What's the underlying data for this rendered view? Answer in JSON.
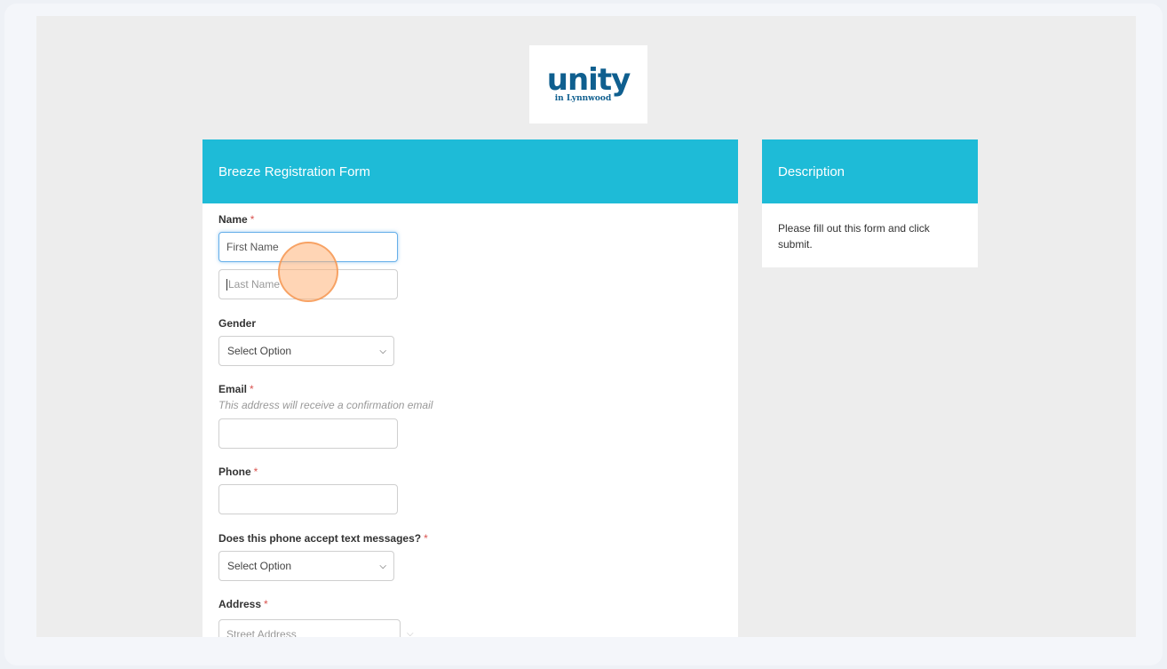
{
  "logo": {
    "word": "unity",
    "sub": "in Lynnwood"
  },
  "form": {
    "title": "Breeze Registration Form",
    "name_label": "Name",
    "first_name_value": "First Name",
    "last_name_placeholder": "Last Name",
    "gender_label": "Gender",
    "gender_value": "Select Option",
    "email_label": "Email",
    "email_help": "This address will receive a confirmation email",
    "phone_label": "Phone",
    "text_label": "Does this phone accept text messages?",
    "text_value": "Select Option",
    "address_label": "Address",
    "street_placeholder": "Street Address",
    "required_mark": "*"
  },
  "description": {
    "title": "Description",
    "body": "Please fill out this form and click submit."
  },
  "icons": {
    "select_chevron": "chevron-down-icon"
  },
  "colors": {
    "header": "#1ebbd7",
    "logo": "#0f5f8f",
    "required": "#d9534f"
  }
}
